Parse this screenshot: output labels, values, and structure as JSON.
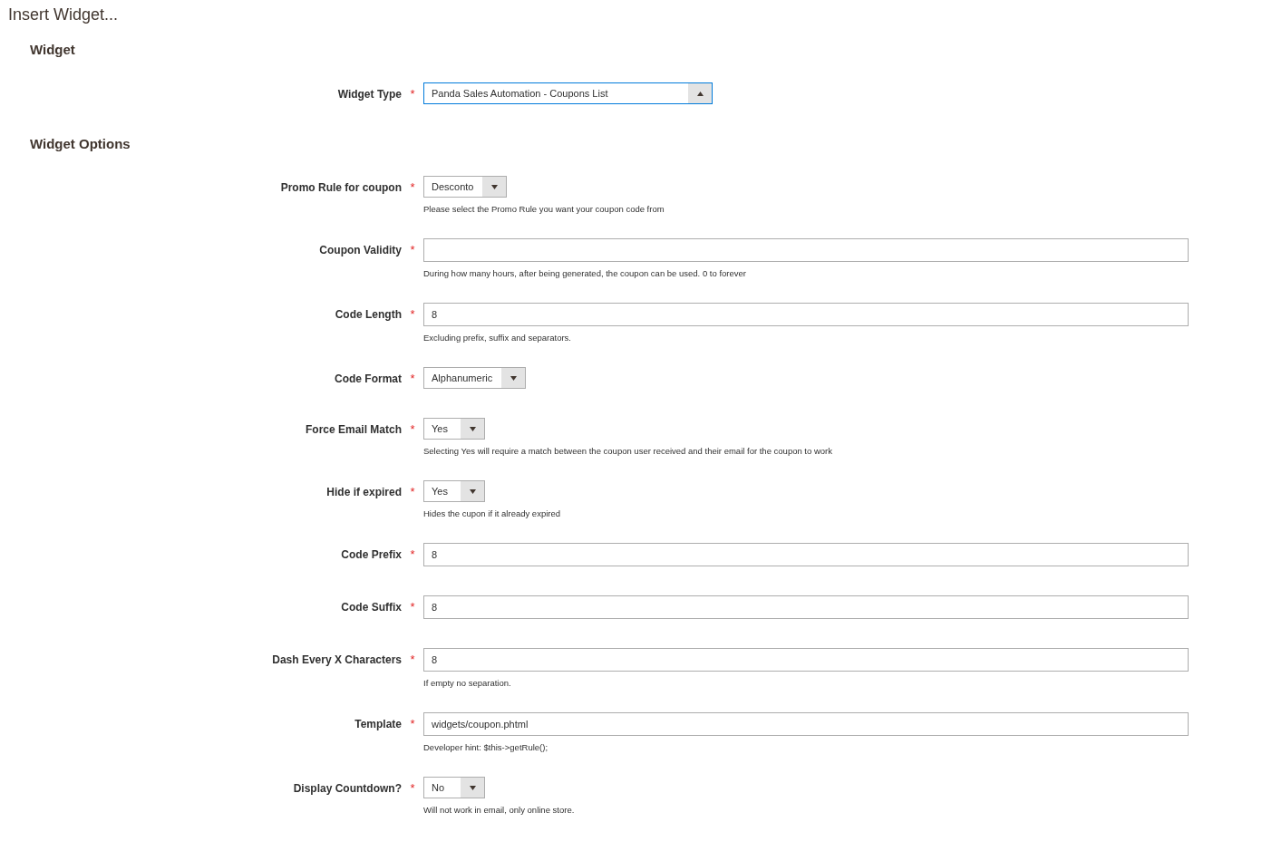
{
  "title": "Insert Widget...",
  "sections": [
    {
      "heading": "Widget",
      "fields": [
        {
          "kind": "wide_select",
          "label": "Widget Type",
          "mark": "*",
          "value": "Panda Sales Automation - Coupons List",
          "expanded": true
        }
      ]
    },
    {
      "heading": "Widget Options",
      "fields": [
        {
          "kind": "select",
          "label": "Promo Rule for coupon",
          "mark": "*",
          "value": "Desconto",
          "expanded": false,
          "hint": "Please select the Promo Rule you want your coupon code from"
        },
        {
          "kind": "text",
          "label": "Coupon Validity",
          "mark": "*",
          "hint": "During how many hours, after being generated, the coupon can be used. 0 to forever"
        },
        {
          "kind": "text",
          "label": "Code Length",
          "mark": "*",
          "value": "8",
          "hint": "Excluding prefix, suffix and separators."
        },
        {
          "kind": "select",
          "label": "Code Format",
          "mark": "*",
          "value": "Alphanumeric",
          "expanded": false
        },
        {
          "kind": "select",
          "label": "Force Email Match",
          "mark": "*",
          "value": "Yes",
          "expanded": false,
          "hint": "Selecting Yes will require a match between the coupon user received and their email for the coupon to work"
        },
        {
          "kind": "select",
          "label": "Hide if expired",
          "mark": "*",
          "value": "Yes",
          "expanded": false,
          "hint": "Hides the cupon if it already expired"
        },
        {
          "kind": "text",
          "label": "Code Prefix",
          "mark": "*",
          "value": "8"
        },
        {
          "kind": "text",
          "label": "Code Suffix",
          "mark": "*",
          "value": "8"
        },
        {
          "kind": "text",
          "label": "Dash Every X Characters",
          "mark": "*",
          "value": "8",
          "hint": "If empty no separation."
        },
        {
          "kind": "text",
          "label": "Template",
          "mark": "*",
          "value": "widgets/coupon.phtml",
          "hint": "Developer hint: $this->getRule();"
        },
        {
          "kind": "select",
          "label": "Display Countdown?",
          "mark": "*",
          "value": "No",
          "expanded": false,
          "hint": "Will not work in email, only online store."
        }
      ]
    }
  ]
}
